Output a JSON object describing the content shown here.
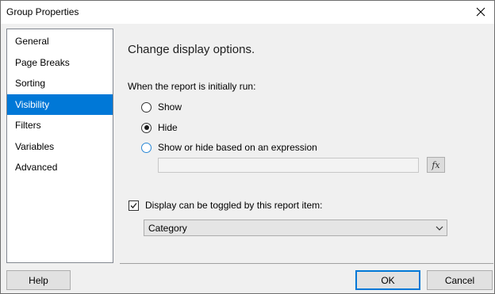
{
  "window": {
    "title": "Group Properties",
    "close_icon": "close-icon"
  },
  "sidebar": {
    "items": [
      {
        "label": "General",
        "selected": false
      },
      {
        "label": "Page Breaks",
        "selected": false
      },
      {
        "label": "Sorting",
        "selected": false
      },
      {
        "label": "Visibility",
        "selected": true
      },
      {
        "label": "Filters",
        "selected": false
      },
      {
        "label": "Variables",
        "selected": false
      },
      {
        "label": "Advanced",
        "selected": false
      }
    ],
    "selected_color": "#0078d7"
  },
  "content": {
    "heading": "Change display options.",
    "run_label": "When the report is initially run:",
    "radios": [
      {
        "label": "Show",
        "checked": false
      },
      {
        "label": "Hide",
        "checked": true
      },
      {
        "label": "Show or hide based on an expression",
        "checked": false
      }
    ],
    "expression_value": "",
    "fx_icon": "function-icon",
    "fx_label": "fx",
    "toggle_checkbox": {
      "label": "Display can be toggled by this report item:",
      "checked": true
    },
    "toggle_select": {
      "value": "Category"
    }
  },
  "footer": {
    "help_label": "Help",
    "ok_label": "OK",
    "cancel_label": "Cancel"
  }
}
